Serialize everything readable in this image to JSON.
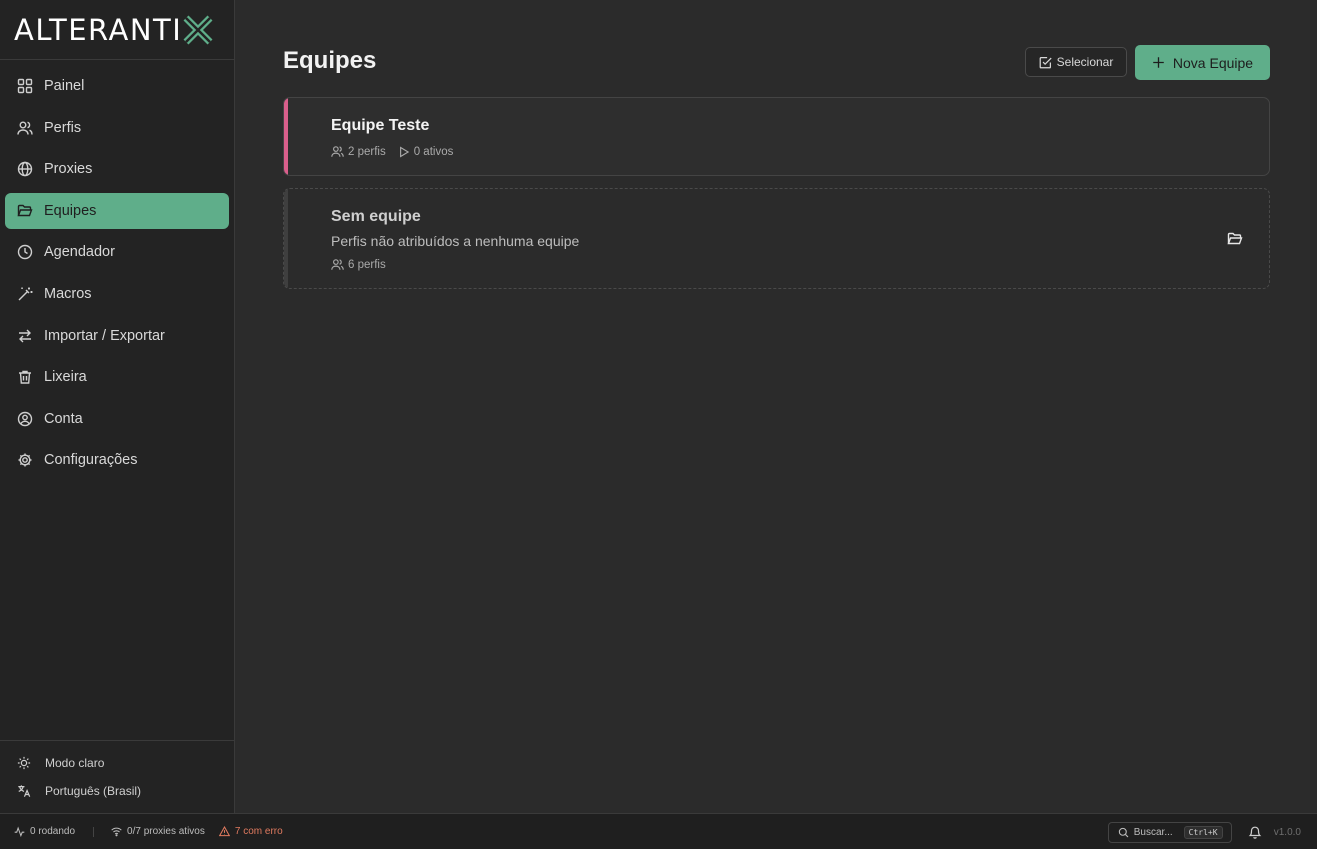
{
  "app": {
    "logo_text": "ALTERANTI",
    "logo_mark": "X"
  },
  "sidebar": {
    "items": [
      {
        "label": "Painel",
        "icon": "grid-icon"
      },
      {
        "label": "Perfis",
        "icon": "users-icon"
      },
      {
        "label": "Proxies",
        "icon": "globe-icon"
      },
      {
        "label": "Equipes",
        "icon": "folder-open-icon",
        "active": true
      },
      {
        "label": "Agendador",
        "icon": "clock-icon"
      },
      {
        "label": "Macros",
        "icon": "wand-icon"
      },
      {
        "label": "Importar / Exportar",
        "icon": "arrows-icon"
      },
      {
        "label": "Lixeira",
        "icon": "trash-icon"
      },
      {
        "label": "Conta",
        "icon": "user-circle-icon"
      },
      {
        "label": "Configurações",
        "icon": "gear-icon"
      }
    ],
    "bottom": {
      "theme_label": "Modo claro",
      "language_label": "Português (Brasil)"
    }
  },
  "main": {
    "title": "Equipes",
    "select_label": "Selecionar",
    "new_team_label": "Nova Equipe",
    "teams": [
      {
        "name": "Equipe Teste",
        "profiles": "2 perfis",
        "active": "0 ativos",
        "accent": "#d95f8c"
      }
    ],
    "no_team": {
      "name": "Sem equipe",
      "description": "Perfis não atribuídos a nenhuma equipe",
      "profiles": "6 perfis"
    }
  },
  "statusbar": {
    "running": "0 rodando",
    "proxies": "0/7 proxies ativos",
    "errors": "7 com erro",
    "search_placeholder": "Buscar...",
    "shortcut": "Ctrl+K",
    "version": "v1.0.0"
  },
  "colors": {
    "accent": "#5fae8a",
    "team_accent": "#d95f8c",
    "error": "#e07a5f",
    "background": "#2b2b2b",
    "sidebar": "#232323"
  }
}
